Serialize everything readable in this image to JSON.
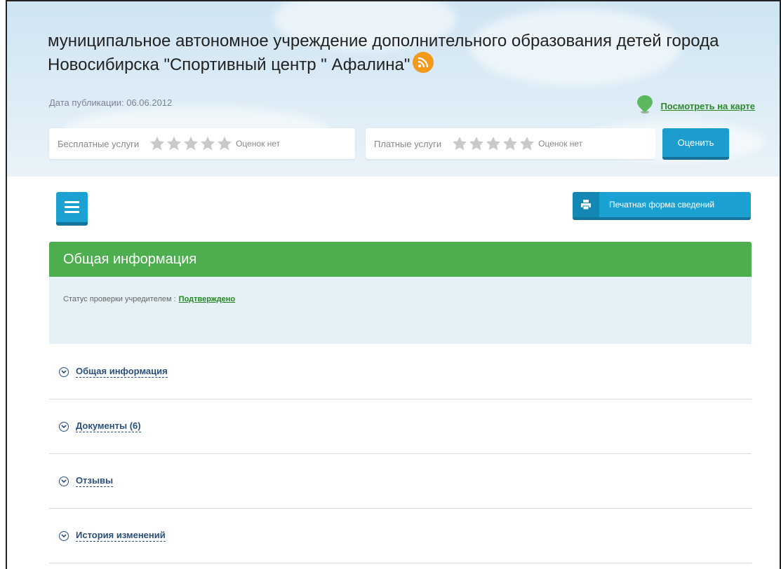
{
  "header": {
    "title": "муниципальное автономное учреждение дополнительного образования детей города Новосибирска \"Спортивный центр \" Афалина\"",
    "pub_date": "Дата публикации: 06.06.2012",
    "map_link": "Посмотреть на карте"
  },
  "ratings": {
    "free": {
      "label": "Бесплатные услуги",
      "status": "Оценок нет",
      "stars_filled": 0,
      "stars_total": 5
    },
    "paid": {
      "label": "Платные услуги",
      "status": "Оценок нет",
      "stars_filled": 0,
      "stars_total": 5
    },
    "rate_button": "Оценить"
  },
  "toolbar": {
    "print_label": "Печатная форма сведений"
  },
  "general": {
    "heading": "Общая информация",
    "status_label": "Статус проверки учредителем :",
    "status_value": "Подтверждено"
  },
  "accordion": [
    {
      "label": "Общая информация"
    },
    {
      "label": "Документы (6)"
    },
    {
      "label": "Отзывы"
    },
    {
      "label": "История изменений"
    }
  ],
  "colors": {
    "accent_blue": "#1ba2d2",
    "section_green": "#4cae4f",
    "link_green": "#2a8a2a",
    "rss_orange": "#f39a1b"
  }
}
